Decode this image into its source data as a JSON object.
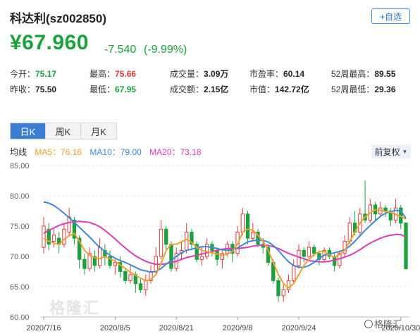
{
  "header": {
    "title": "科达利(sz002850)",
    "add_button": "+自选"
  },
  "price": {
    "current": "¥67.960",
    "change": "-7.540",
    "change_pct": "(-9.99%)"
  },
  "quote": [
    {
      "label": "今开：",
      "value": "75.17",
      "tone": "green"
    },
    {
      "label": "最高：",
      "value": "75.66",
      "tone": "red"
    },
    {
      "label": "成交量：",
      "value": "3.09万",
      "tone": "plain"
    },
    {
      "label": "市盈率：",
      "value": "60.14",
      "tone": "plain"
    },
    {
      "label": "52周最高：",
      "value": "89.55",
      "tone": "plain"
    },
    {
      "label": "昨收：",
      "value": "75.50",
      "tone": "plain"
    },
    {
      "label": "最低：",
      "value": "67.95",
      "tone": "green"
    },
    {
      "label": "成交额：",
      "value": "2.15亿",
      "tone": "plain"
    },
    {
      "label": "市值：",
      "value": "142.72亿",
      "tone": "plain"
    },
    {
      "label": "52周最低：",
      "value": "29.36",
      "tone": "plain"
    }
  ],
  "tabs": [
    {
      "label": "日K",
      "active": true
    },
    {
      "label": "周K",
      "active": false
    },
    {
      "label": "月K",
      "active": false
    }
  ],
  "legend": {
    "title": "均线",
    "ma5": "MA5：76.16",
    "ma10": "MA10：79.00",
    "ma20": "MA20：73.18"
  },
  "adjust_label": "前复权",
  "watermark": "格隆汇",
  "watermark_corner": "格隆汇",
  "colors": {
    "up": "#e23b3b",
    "down": "#19a33a",
    "ma5": "#f0a030",
    "ma10": "#3f88d8",
    "ma20": "#de3bb6"
  },
  "chart_data": {
    "type": "candlestick",
    "ylim": [
      60,
      85
    ],
    "yticks": [
      "85.00",
      "80.00",
      "75.00",
      "70.00",
      "65.00",
      "60.00"
    ],
    "xticks": [
      {
        "label": "2020/7/16",
        "index": 0
      },
      {
        "label": "2020/8/5",
        "index": 14
      },
      {
        "label": "2020/8/21",
        "index": 26
      },
      {
        "label": "2020/9/8",
        "index": 38
      },
      {
        "label": "2020/9/24",
        "index": 50
      },
      {
        "label": "2020/10/30",
        "index": 70
      }
    ],
    "candles": [
      [
        71.5,
        75.0,
        76.5,
        70.5
      ],
      [
        74.5,
        72.0,
        75.5,
        71.0
      ],
      [
        72.5,
        73.5,
        74.5,
        71.5
      ],
      [
        73.0,
        72.0,
        74.0,
        70.5
      ],
      [
        72.0,
        74.5,
        75.5,
        71.5
      ],
      [
        74.0,
        76.5,
        78.0,
        73.5
      ],
      [
        76.0,
        73.0,
        76.5,
        72.0
      ],
      [
        73.0,
        69.5,
        73.5,
        68.0
      ],
      [
        69.5,
        68.0,
        70.5,
        67.0
      ],
      [
        68.0,
        70.5,
        71.5,
        67.5
      ],
      [
        70.0,
        68.5,
        71.0,
        67.5
      ],
      [
        68.5,
        71.5,
        73.0,
        68.0
      ],
      [
        71.0,
        70.0,
        72.0,
        68.5
      ],
      [
        70.0,
        68.5,
        71.0,
        68.0
      ],
      [
        68.5,
        69.0,
        69.5,
        67.0
      ],
      [
        69.0,
        67.5,
        70.0,
        66.5
      ],
      [
        67.5,
        66.0,
        68.0,
        65.5
      ],
      [
        66.0,
        67.0,
        68.5,
        65.5
      ],
      [
        67.0,
        65.5,
        67.5,
        64.0
      ],
      [
        65.5,
        64.5,
        66.5,
        64.0
      ],
      [
        64.5,
        66.0,
        67.0,
        63.5
      ],
      [
        66.0,
        67.5,
        68.5,
        65.5
      ],
      [
        67.5,
        70.0,
        71.5,
        67.0
      ],
      [
        70.0,
        74.5,
        76.0,
        69.5
      ],
      [
        74.5,
        72.0,
        75.0,
        71.0
      ],
      [
        72.0,
        68.0,
        72.5,
        67.5
      ],
      [
        68.0,
        70.5,
        71.5,
        67.5
      ],
      [
        70.5,
        71.0,
        72.5,
        69.5
      ],
      [
        71.0,
        74.0,
        75.5,
        70.5
      ],
      [
        74.0,
        72.0,
        74.5,
        71.0
      ],
      [
        72.0,
        69.5,
        72.5,
        69.0
      ],
      [
        69.5,
        70.0,
        71.5,
        68.5
      ],
      [
        70.0,
        72.0,
        73.0,
        69.5
      ],
      [
        72.0,
        71.0,
        72.5,
        70.0
      ],
      [
        71.0,
        69.5,
        71.5,
        68.5
      ],
      [
        69.5,
        70.5,
        71.0,
        68.0
      ],
      [
        70.5,
        72.0,
        72.5,
        70.0
      ],
      [
        72.0,
        70.5,
        72.5,
        69.0
      ],
      [
        70.5,
        74.0,
        75.0,
        70.0
      ],
      [
        74.0,
        77.0,
        78.0,
        73.5
      ],
      [
        77.0,
        73.0,
        77.5,
        72.0
      ],
      [
        73.0,
        74.0,
        75.5,
        72.5
      ],
      [
        74.0,
        72.0,
        74.5,
        71.5
      ],
      [
        72.0,
        71.5,
        73.0,
        70.5
      ],
      [
        71.5,
        69.0,
        72.0,
        68.5
      ],
      [
        69.0,
        66.0,
        69.5,
        65.5
      ],
      [
        66.0,
        63.5,
        66.5,
        62.5
      ],
      [
        63.5,
        64.5,
        65.5,
        62.5
      ],
      [
        64.5,
        66.0,
        67.0,
        64.0
      ],
      [
        66.0,
        68.5,
        69.5,
        65.5
      ],
      [
        68.5,
        71.0,
        72.0,
        68.0
      ],
      [
        71.0,
        70.0,
        71.5,
        69.0
      ],
      [
        70.0,
        71.5,
        72.5,
        69.5
      ],
      [
        71.5,
        70.5,
        72.0,
        70.0
      ],
      [
        70.5,
        69.5,
        71.0,
        68.5
      ],
      [
        69.5,
        71.0,
        71.5,
        69.0
      ],
      [
        71.0,
        70.0,
        71.5,
        69.5
      ],
      [
        70.0,
        68.5,
        70.5,
        67.5
      ],
      [
        68.5,
        70.5,
        71.0,
        68.0
      ],
      [
        70.5,
        72.5,
        73.5,
        70.0
      ],
      [
        72.5,
        75.5,
        76.5,
        72.0
      ],
      [
        75.5,
        74.0,
        77.5,
        73.5
      ],
      [
        74.0,
        77.0,
        78.0,
        73.5
      ],
      [
        77.0,
        76.0,
        82.5,
        75.5
      ],
      [
        76.0,
        78.5,
        79.5,
        75.5
      ],
      [
        78.5,
        77.0,
        79.0,
        76.0
      ],
      [
        77.0,
        78.0,
        79.0,
        76.5
      ],
      [
        78.0,
        77.5,
        78.5,
        76.5
      ],
      [
        77.5,
        76.0,
        78.0,
        75.0
      ],
      [
        76.0,
        78.0,
        79.5,
        75.5
      ],
      [
        78.0,
        75.5,
        78.5,
        74.5
      ],
      [
        75.5,
        67.96,
        75.66,
        67.95
      ]
    ],
    "ma5": [
      73.0,
      72.5,
      72.2,
      72.0,
      72.8,
      73.4,
      73.8,
      72.5,
      71.0,
      70.2,
      69.8,
      69.6,
      70.0,
      69.6,
      69.2,
      68.6,
      68.0,
      67.4,
      66.9,
      66.4,
      66.0,
      66.2,
      67.0,
      68.8,
      71.0,
      72.0,
      72.0,
      72.4,
      72.8,
      72.3,
      71.5,
      71.0,
      70.8,
      70.6,
      70.4,
      70.2,
      70.4,
      70.8,
      72.0,
      74.0,
      74.5,
      74.3,
      73.5,
      72.5,
      71.0,
      69.0,
      67.0,
      65.5,
      64.8,
      65.5,
      67.0,
      68.5,
      69.5,
      70.3,
      70.8,
      70.8,
      70.2,
      69.9,
      70.3,
      71.0,
      72.5,
      74.0,
      75.5,
      76.5,
      77.2,
      77.7,
      77.6,
      77.4,
      77.3,
      76.9,
      76.6,
      76.16
    ],
    "ma10": [
      79.0,
      78.8,
      78.4,
      77.8,
      77.1,
      76.4,
      75.6,
      74.8,
      74.0,
      73.2,
      72.3,
      71.5,
      70.8,
      70.2,
      69.7,
      69.3,
      69.0,
      68.6,
      68.2,
      67.8,
      67.6,
      67.4,
      67.5,
      68.0,
      68.7,
      69.3,
      70.0,
      70.6,
      71.0,
      71.2,
      71.4,
      71.6,
      71.6,
      71.5,
      71.3,
      71.1,
      71.0,
      71.1,
      71.4,
      71.9,
      72.4,
      72.6,
      72.7,
      72.6,
      72.4,
      71.8,
      71.0,
      70.0,
      69.1,
      68.5,
      68.2,
      68.2,
      68.5,
      69.0,
      69.7,
      70.2,
      70.4,
      70.6,
      70.8,
      71.1,
      71.7,
      72.5,
      73.4,
      74.3,
      75.1,
      75.9,
      76.6,
      77.1,
      77.4,
      77.6,
      77.5,
      76.3
    ],
    "ma20": [
      73.8,
      74.3,
      74.7,
      75.1,
      75.4,
      75.6,
      75.7,
      75.8,
      75.7,
      75.6,
      75.3,
      74.9,
      74.3,
      73.6,
      72.9,
      72.1,
      71.4,
      70.7,
      70.1,
      69.6,
      69.2,
      68.9,
      68.7,
      68.7,
      68.8,
      69.0,
      69.2,
      69.5,
      69.8,
      70.0,
      70.2,
      70.4,
      70.6,
      70.8,
      71.0,
      71.2,
      71.3,
      71.3,
      71.3,
      71.4,
      71.5,
      71.7,
      71.8,
      71.9,
      71.8,
      71.6,
      71.3,
      70.9,
      70.5,
      70.2,
      69.9,
      69.6,
      69.3,
      69.2,
      69.1,
      69.1,
      69.2,
      69.4,
      69.6,
      69.9,
      70.2,
      70.6,
      71.1,
      71.7,
      72.2,
      72.6,
      73.0,
      73.3,
      73.5,
      73.6,
      73.6,
      73.18
    ]
  }
}
